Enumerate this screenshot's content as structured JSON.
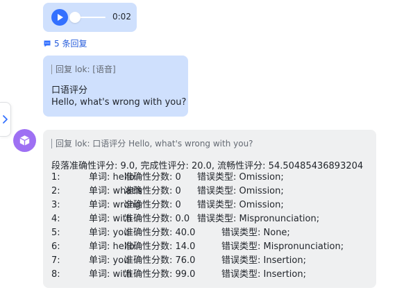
{
  "audio": {
    "time": "0:02",
    "progress": 0.0
  },
  "reply_link": {
    "count_label": "5 条回复"
  },
  "user_message": {
    "quote": "回复 lok: [语音]",
    "line1": "口语评分",
    "line2": "Hello, what's wrong with you?"
  },
  "bot_message": {
    "quote": "回复 lok: 口语评分 Hello, what's wrong with you?",
    "summary": "段落准确性评分: 9.0, 完成性评分: 20.0, 流畅性评分: 54.50485436893204",
    "rows": [
      {
        "idx": "1:",
        "word": "单词: hello",
        "score": "准确性分数: 0",
        "type": "错误类型: Omission;"
      },
      {
        "idx": "2:",
        "word": "单词: what's",
        "score": "准确性分数: 0",
        "type": "错误类型: Omission;"
      },
      {
        "idx": "3:",
        "word": "单词: wrong",
        "score": "准确性分数: 0",
        "type": "错误类型: Omission;"
      },
      {
        "idx": "4:",
        "word": "单词: with",
        "score": "准确性分数: 0.0",
        "type": "错误类型: Mispronunciation;"
      },
      {
        "idx": "5:",
        "word": "单词: you",
        "score": "准确性分数: 40.0",
        "type": "错误类型: None;"
      },
      {
        "idx": "6:",
        "word": "单词: hello",
        "score": "准确性分数: 14.0",
        "type": "错误类型: Mispronunciation;"
      },
      {
        "idx": "7:",
        "word": "单词: you",
        "score": "准确性分数: 76.0",
        "type": "错误类型: Insertion;"
      },
      {
        "idx": "8:",
        "word": "单词: with",
        "score": "准确性分数: 99.0",
        "type": "错误类型: Insertion;"
      }
    ]
  },
  "icons": {
    "side_toggle": "chevron-right-icon",
    "play": "play-icon",
    "reply": "comment-icon",
    "avatar": "cube-icon"
  },
  "colors": {
    "accent": "#3370ff",
    "link": "#245bdb",
    "user_bubble": "#cfe0fd",
    "bot_bubble": "#eff0f1",
    "avatar_bg": "#9e70f3"
  }
}
